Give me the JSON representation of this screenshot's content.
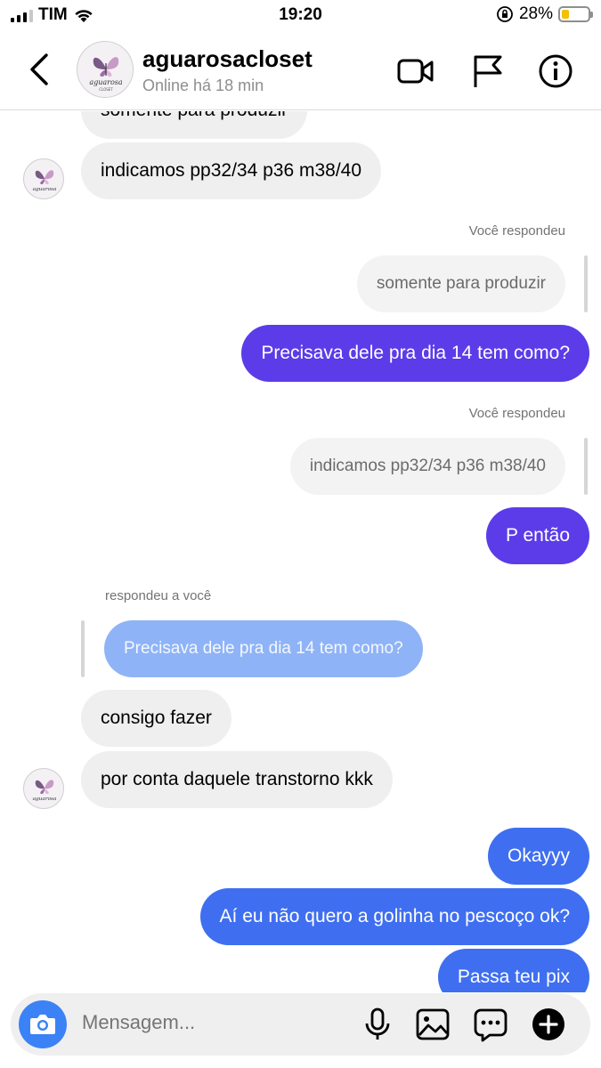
{
  "status_bar": {
    "carrier": "TIM",
    "time": "19:20",
    "battery_percent": "28%",
    "battery_level": 0.28
  },
  "header": {
    "username": "aguarosacloset",
    "status": "Online há 18 min",
    "avatar_text": "aguarosa",
    "avatar_subtext": "CLOSET"
  },
  "messages": [
    {
      "side": "in",
      "text": "somente para produzir"
    },
    {
      "side": "in",
      "text": "indicamos pp32/34 p36 m38/40"
    },
    {
      "side": "out",
      "reply_label": "Você respondeu",
      "quoted": "somente para produzir",
      "text": "Precisava dele pra dia 14 tem como?"
    },
    {
      "side": "out",
      "reply_label": "Você respondeu",
      "quoted": "indicamos pp32/34 p36 m38/40",
      "text": "P então"
    },
    {
      "side": "in",
      "reply_label": "respondeu a você",
      "quoted": "Precisava dele pra dia 14 tem como?"
    },
    {
      "side": "in",
      "text": "consigo fazer"
    },
    {
      "side": "in",
      "text": "por conta daquele transtorno kkk"
    },
    {
      "side": "out",
      "text": "Okayyy"
    },
    {
      "side": "out",
      "text": "Aí eu não quero a golinha no pescoço ok?"
    },
    {
      "side": "out",
      "text": "Passa teu pix"
    }
  ],
  "composer": {
    "placeholder": "Mensagem..."
  },
  "colors": {
    "outgoing_blue": "#3f6ff0",
    "outgoing_violet": "#5b3ce8",
    "incoming_gray": "#efefef",
    "quoted_blue": "#8fb3f7",
    "camera_button": "#3b82f6"
  },
  "icons": [
    "back-chevron-icon",
    "video-call-icon",
    "flag-icon",
    "info-icon",
    "camera-icon",
    "microphone-icon",
    "gallery-icon",
    "sticker-icon",
    "plus-icon"
  ]
}
